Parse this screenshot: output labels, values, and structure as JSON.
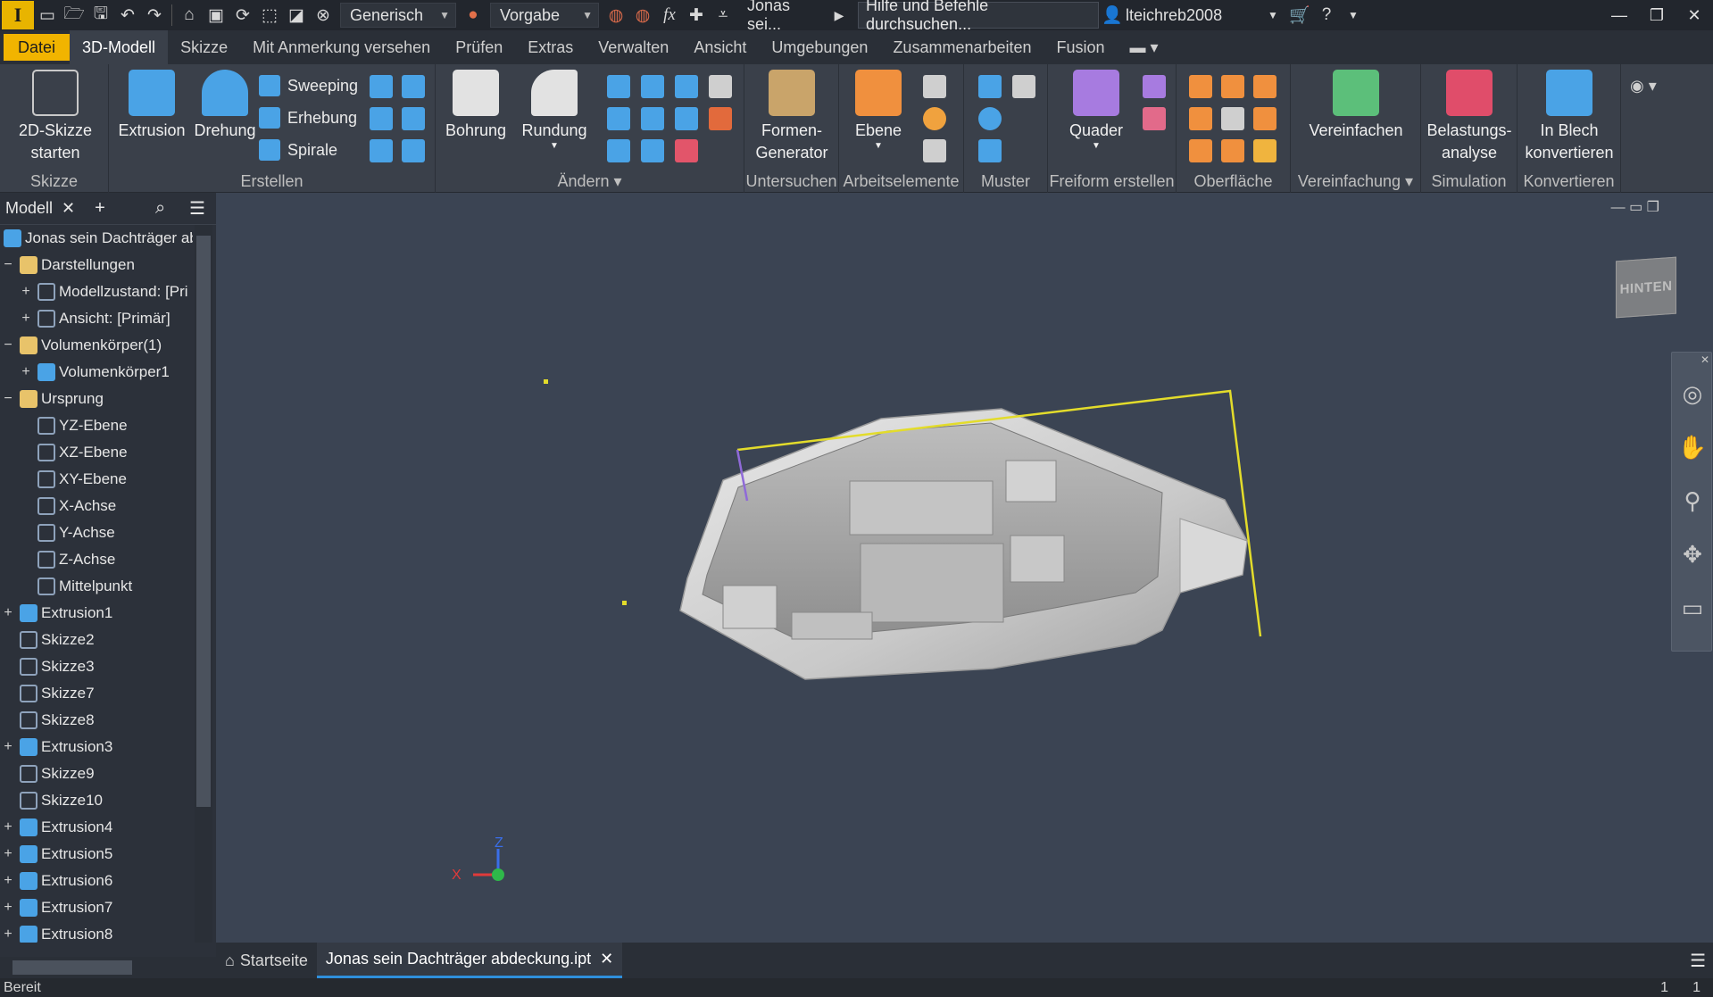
{
  "qat": {
    "app_logo": "I",
    "appearance_dropdown": "Generisch",
    "material_dropdown": "Vorgabe",
    "doc_name_short": "Jonas sei...",
    "search_placeholder": "Hilfe und Befehle durchsuchen...",
    "user_name": "lteichreb2008"
  },
  "tabs": [
    "Datei",
    "3D-Modell",
    "Skizze",
    "Mit Anmerkung versehen",
    "Prüfen",
    "Extras",
    "Verwalten",
    "Ansicht",
    "Umgebungen",
    "Zusammenarbeiten",
    "Fusion"
  ],
  "ribbon": {
    "skizze": {
      "title": "Skizze",
      "start_line1": "2D-Skizze",
      "start_line2": "starten"
    },
    "erstellen": {
      "title": "Erstellen",
      "extrusion": "Extrusion",
      "drehung": "Drehung",
      "sweeping": "Sweeping",
      "erhebung": "Erhebung",
      "spirale": "Spirale"
    },
    "aendern": {
      "title": "Ändern",
      "bohrung": "Bohrung",
      "rundung": "Rundung"
    },
    "untersuchen": {
      "title": "Untersuchen",
      "formen_line1": "Formen-",
      "formen_line2": "Generator"
    },
    "arbeitselemente": {
      "title": "Arbeitselemente",
      "ebene": "Ebene"
    },
    "muster": {
      "title": "Muster"
    },
    "freiform": {
      "title": "Freiform erstellen",
      "quader": "Quader"
    },
    "oberflaeche": {
      "title": "Oberfläche"
    },
    "vereinfachung": {
      "title": "Vereinfachung",
      "vereinfachen": "Vereinfachen"
    },
    "simulation": {
      "title": "Simulation",
      "line1": "Belastungs-",
      "line2": "analyse"
    },
    "konvertieren": {
      "title": "Konvertieren",
      "line1": "In Blech",
      "line2": "konvertieren"
    }
  },
  "browser": {
    "tab_label": "Modell",
    "root": "Jonas sein Dachträger abc",
    "nodes": [
      {
        "label": "Darstellungen",
        "toggle": "−"
      },
      {
        "label": "Modellzustand: [Pri",
        "toggle": "+"
      },
      {
        "label": "Ansicht: [Primär]",
        "toggle": "+"
      },
      {
        "label": "Volumenkörper(1)",
        "toggle": "−"
      },
      {
        "label": "Volumenkörper1",
        "toggle": "+"
      },
      {
        "label": "Ursprung",
        "toggle": "−"
      },
      {
        "label": "YZ-Ebene",
        "toggle": ""
      },
      {
        "label": "XZ-Ebene",
        "toggle": ""
      },
      {
        "label": "XY-Ebene",
        "toggle": ""
      },
      {
        "label": "X-Achse",
        "toggle": ""
      },
      {
        "label": "Y-Achse",
        "toggle": ""
      },
      {
        "label": "Z-Achse",
        "toggle": ""
      },
      {
        "label": "Mittelpunkt",
        "toggle": ""
      },
      {
        "label": "Extrusion1",
        "toggle": "+"
      },
      {
        "label": "Skizze2",
        "toggle": ""
      },
      {
        "label": "Skizze3",
        "toggle": ""
      },
      {
        "label": "Skizze7",
        "toggle": ""
      },
      {
        "label": "Skizze8",
        "toggle": ""
      },
      {
        "label": "Extrusion3",
        "toggle": "+"
      },
      {
        "label": "Skizze9",
        "toggle": ""
      },
      {
        "label": "Skizze10",
        "toggle": ""
      },
      {
        "label": "Extrusion4",
        "toggle": "+"
      },
      {
        "label": "Extrusion5",
        "toggle": "+"
      },
      {
        "label": "Extrusion6",
        "toggle": "+"
      },
      {
        "label": "Extrusion7",
        "toggle": "+"
      },
      {
        "label": "Extrusion8",
        "toggle": "+"
      }
    ]
  },
  "viewport": {
    "viewcube_label": "HINTEN",
    "axis_x": "X",
    "axis_z": "Z"
  },
  "doc_tabs": {
    "home": "Startseite",
    "active": "Jonas sein Dachträger abdeckung.ipt"
  },
  "status": {
    "text": "Bereit",
    "count1": "1",
    "count2": "1"
  },
  "colors": {
    "accent": "#f1b400",
    "highlight_line": "#e3dc2b",
    "tab_underline": "#2e8fdc"
  }
}
